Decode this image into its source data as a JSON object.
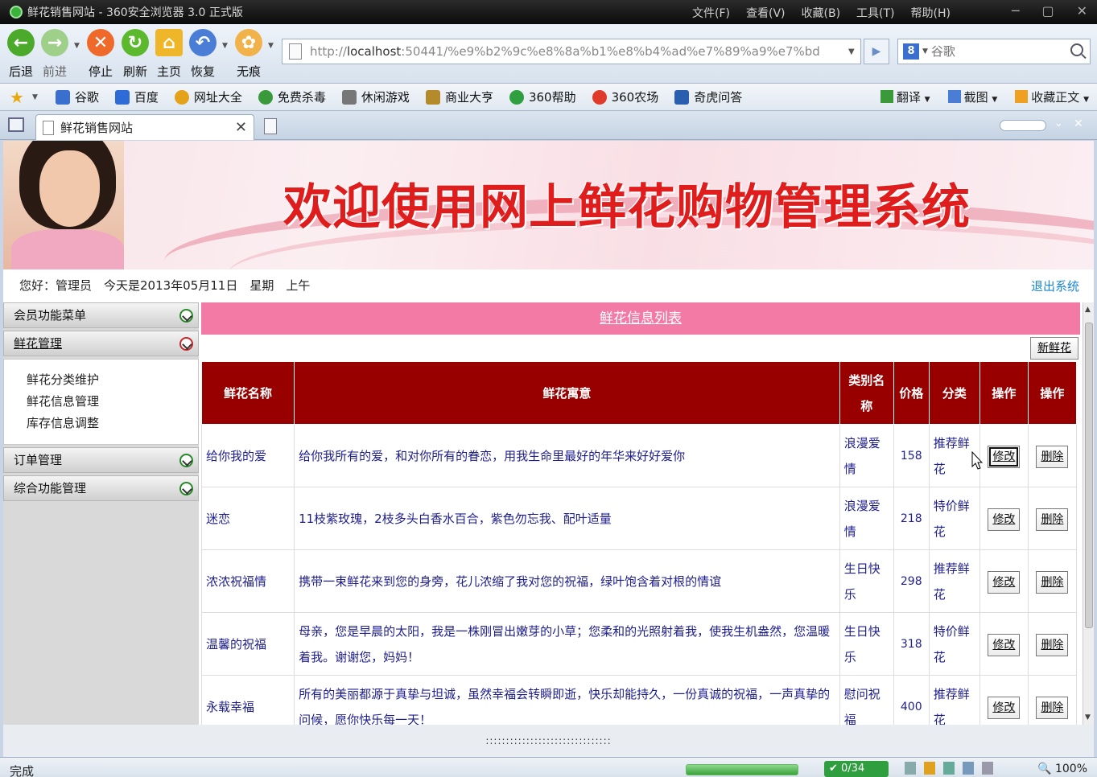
{
  "window": {
    "title": "鲜花销售网站 - 360安全浏览器 3.0 正式版",
    "menus": [
      "文件(F)",
      "查看(V)",
      "收藏(B)",
      "工具(T)",
      "帮助(H)"
    ]
  },
  "nav": {
    "back": "后退",
    "forward": "前进",
    "stop": "停止",
    "refresh": "刷新",
    "home": "主页",
    "restore": "恢复",
    "incognito": "无痕"
  },
  "address": {
    "url_prefix": "http://",
    "url_host": "localhost",
    "url_rest": ":50441/%e9%b2%9c%e8%8a%b1%e8%b4%ad%e7%89%a9%e7%bd"
  },
  "search": {
    "engine": "8",
    "placeholder": "谷歌"
  },
  "favorites": [
    "谷歌",
    "百度",
    "网址大全",
    "免费杀毒",
    "休闲游戏",
    "商业大亨",
    "360帮助",
    "360农场",
    "奇虎问答"
  ],
  "fav_colors": [
    "#3a6fd0",
    "#2f6bd6",
    "#e3a21a",
    "#3a9a3a",
    "#777777",
    "#b58a2a",
    "#2f9f3f",
    "#e03a2a",
    "#2a5fb0"
  ],
  "favright": {
    "translate": "翻译",
    "screenshot": "截图",
    "collect": "收藏正文"
  },
  "tab": {
    "label": "鲜花销售网站"
  },
  "page": {
    "banner_title": "欢迎使用网上鲜花购物管理系统",
    "greeting": "您好：管理员　今天是2013年05月11日　星期　上午",
    "logout": "退出系统"
  },
  "sidebar": {
    "member_menu": "会员功能菜单",
    "flower_mgmt": "鲜花管理",
    "sub_items": [
      "鲜花分类维护",
      "鲜花信息管理",
      "库存信息调整"
    ],
    "order_mgmt": "订单管理",
    "general_mgmt": "综合功能管理"
  },
  "list": {
    "title": "鲜花信息列表",
    "new_button": "新鲜花",
    "headers": [
      "鲜花名称",
      "鲜花寓意",
      "类别名称",
      "价格",
      "分类",
      "操作",
      "操作"
    ],
    "edit_label": "修改",
    "delete_label": "删除",
    "rows": [
      {
        "name": "给你我的爱",
        "meaning": "给你我所有的爱，和对你所有的眷恋，用我生命里最好的年华来好好爱你",
        "category": "浪漫爱情",
        "price": "158",
        "type": "推荐鲜花"
      },
      {
        "name": "迷恋",
        "meaning": "11枝紫玫瑰，2枝多头白香水百合，紫色勿忘我、配叶适量",
        "category": "浪漫爱情",
        "price": "218",
        "type": "特价鲜花"
      },
      {
        "name": "浓浓祝福情",
        "meaning": "携带一束鲜花来到您的身旁，花儿浓缩了我对您的祝福，绿叶饱含着对根的情谊",
        "category": "生日快乐",
        "price": "298",
        "type": "推荐鲜花"
      },
      {
        "name": "温馨的祝福",
        "meaning": "母亲，您是早晨的太阳，我是一株刚冒出嫩芽的小草；您柔和的光照射着我，使我生机盎然，您温暖着我。谢谢您，妈妈！",
        "category": "生日快乐",
        "price": "318",
        "type": "特价鲜花"
      },
      {
        "name": "永载幸福",
        "meaning": "所有的美丽都源于真挚与坦诚，虽然幸福会转瞬即逝，快乐却能持久，一份真诚的祝福，一声真挚的问候，愿你快乐每一天！",
        "category": "慰问祝福",
        "price": "400",
        "type": "推荐鲜花"
      }
    ]
  },
  "status": {
    "text": "完成",
    "counter": "0/34",
    "zoom": "100%"
  }
}
